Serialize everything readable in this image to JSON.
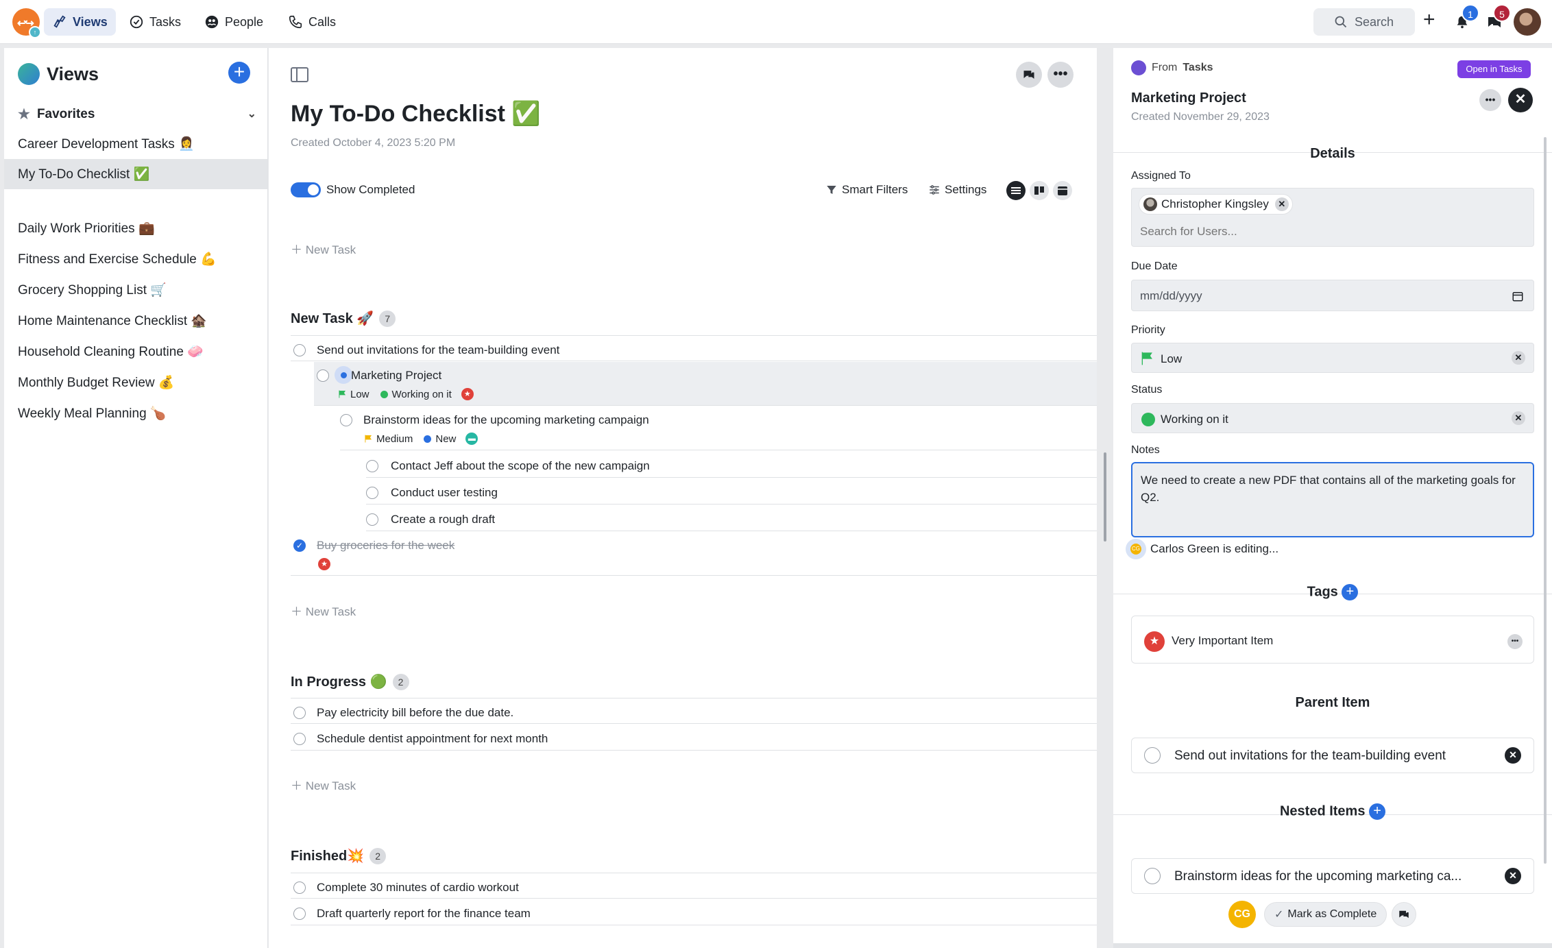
{
  "nav": {
    "tabs": [
      {
        "label": "Views",
        "icon": "binoculars-icon",
        "active": true
      },
      {
        "label": "Tasks",
        "icon": "check-circle-icon"
      },
      {
        "label": "People",
        "icon": "people-icon"
      },
      {
        "label": "Calls",
        "icon": "phone-icon"
      }
    ],
    "search_label": "Search",
    "notifications_count": "1",
    "messages_count": "5"
  },
  "sidebar": {
    "title": "Views",
    "favorites_label": "Favorites",
    "favorites": [
      {
        "label": "Career Development Tasks 👩‍💼"
      },
      {
        "label": "My To-Do Checklist ✅",
        "active": true
      }
    ],
    "views": [
      {
        "label": "Daily Work Priorities 💼"
      },
      {
        "label": "Fitness and Exercise Schedule 💪"
      },
      {
        "label": "Grocery Shopping List 🛒"
      },
      {
        "label": "Home Maintenance Checklist 🏚️"
      },
      {
        "label": "Household Cleaning Routine 🧼"
      },
      {
        "label": "Monthly Budget Review 💰"
      },
      {
        "label": "Weekly Meal Planning 🍗"
      }
    ]
  },
  "main": {
    "title": "My To-Do Checklist ✅",
    "created": "Created October 4, 2023 5:20 PM",
    "show_completed_label": "Show Completed",
    "smart_filters_label": "Smart Filters",
    "settings_label": "Settings",
    "new_task_label": "New Task",
    "groups": [
      {
        "name": "New Task 🚀",
        "count": "7",
        "tasks": [
          {
            "text": "Send out invitations for the team-building event"
          },
          {
            "text": "Marketing Project",
            "priority": "Low",
            "status": "Working on it"
          },
          {
            "text": "Brainstorm ideas for the upcoming marketing campaign",
            "priority": "Medium",
            "status": "New"
          },
          {
            "text": "Contact Jeff about the scope of the new campaign"
          },
          {
            "text": "Conduct user testing"
          },
          {
            "text": "Create a rough draft"
          },
          {
            "text": "Buy groceries for the week",
            "completed": true
          }
        ]
      },
      {
        "name": "In Progress 🟢",
        "count": "2",
        "tasks": [
          {
            "text": "Pay electricity bill before the due date."
          },
          {
            "text": "Schedule dentist appointment for next month"
          }
        ]
      },
      {
        "name": "Finished💥",
        "count": "2",
        "tasks": [
          {
            "text": "Complete 30 minutes of cardio workout"
          },
          {
            "text": "Draft quarterly report for the finance team"
          }
        ]
      }
    ]
  },
  "detail": {
    "from_label": "From",
    "from_source": "Tasks",
    "open_in_tasks_label": "Open in Tasks",
    "title": "Marketing Project",
    "created": "Created November 29, 2023",
    "details_heading": "Details",
    "assigned_label": "Assigned To",
    "assignee": "Christopher Kingsley",
    "search_users_placeholder": "Search for Users...",
    "due_date_label": "Due Date",
    "due_date_placeholder": "mm/dd/yyyy",
    "priority_label": "Priority",
    "priority_value": "Low",
    "status_label": "Status",
    "status_value": "Working on it",
    "notes_label": "Notes",
    "notes_value": "We need to create a new PDF that contains all of the marketing goals for Q2.",
    "editing_text": "Carlos Green is editing...",
    "tags_heading": "Tags",
    "tag": "Very Important Item",
    "parent_heading": "Parent Item",
    "parent_item": "Send out invitations for the team-building event",
    "nested_heading": "Nested Items",
    "nested_item": "Brainstorm ideas for the upcoming marketing ca...",
    "user_initials": "CG",
    "mark_complete_label": "Mark as Complete"
  },
  "colors": {
    "accent": "#2a6fe0",
    "status_green": "#2eb85c",
    "flag_green": "#2eb85c",
    "flag_yellow": "#f2b705",
    "danger": "#e0413a",
    "purple": "#7c3fe4",
    "logo_orange": "#f07a2a"
  }
}
